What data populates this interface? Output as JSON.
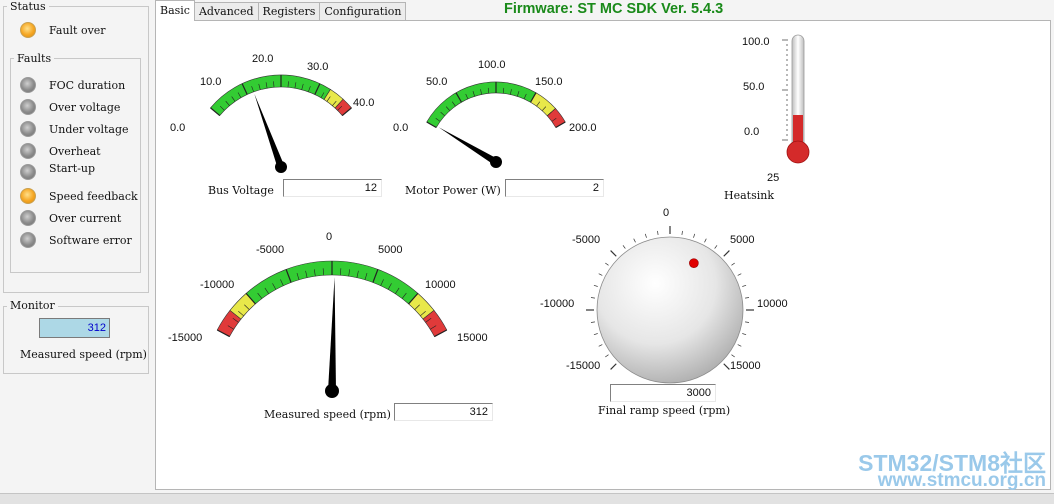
{
  "status_group": {
    "title": "Status",
    "items": [
      {
        "label": "Fault over",
        "state": "on"
      }
    ]
  },
  "faults_group": {
    "title": "Faults",
    "items": [
      {
        "label": "FOC duration",
        "state": "off"
      },
      {
        "label": "Over voltage",
        "state": "off"
      },
      {
        "label": "Under voltage",
        "state": "off"
      },
      {
        "label": "Overheat",
        "state": "off"
      },
      {
        "label": "Start-up",
        "state": "off"
      },
      {
        "label": "Speed feedback",
        "state": "on"
      },
      {
        "label": "Over current",
        "state": "off"
      },
      {
        "label": "Software error",
        "state": "off"
      }
    ]
  },
  "monitor_group": {
    "title": "Monitor",
    "value": "312",
    "label": "Measured speed (rpm)"
  },
  "tabs": [
    {
      "label": "Basic",
      "active": true
    },
    {
      "label": "Advanced",
      "active": false
    },
    {
      "label": "Registers",
      "active": false
    },
    {
      "label": "Configuration",
      "active": false
    }
  ],
  "firmware": "Firmware: ST MC SDK Ver. 5.4.3",
  "bus_voltage": {
    "label": "Bus Voltage",
    "value": "12",
    "gauge_value": 12,
    "min": 0,
    "max": 40,
    "tick_labels": [
      "0.0",
      "10.0",
      "20.0",
      "30.0",
      "40.0"
    ]
  },
  "motor_power": {
    "label": "Motor Power (W)",
    "value": "2",
    "gauge_value": 2,
    "min": 0,
    "max": 200,
    "tick_labels": [
      "0.0",
      "50.0",
      "100.0",
      "150.0",
      "200.0"
    ]
  },
  "heatsink": {
    "label": "Heatsink",
    "value": "25",
    "level": 25,
    "min": 0,
    "max": 100,
    "tick_labels": [
      "100.0",
      "50.0",
      "0.0"
    ]
  },
  "measured_speed": {
    "label": "Measured speed (rpm)",
    "value": "312",
    "gauge_value": 312,
    "min": -15000,
    "max": 15000,
    "tick_labels": [
      "-15000",
      "-10000",
      "-5000",
      "0",
      "5000",
      "10000",
      "15000"
    ]
  },
  "final_ramp_speed": {
    "label": "Final ramp speed (rpm)",
    "value": "3000",
    "knob_value": 3000,
    "min": -15000,
    "max": 15000,
    "tick_labels": [
      "-15000",
      "-10000",
      "-5000",
      "0",
      "5000",
      "10000",
      "15000"
    ]
  },
  "colors": {
    "green": "#33cc33",
    "yellow": "#e8e84a",
    "red": "#e03a3a",
    "firmware_green": "#1a8a1a",
    "led_on": "#f5a623",
    "monitor_bg": "#add8e6",
    "monitor_text": "#0000cc"
  },
  "watermark": {
    "line1": "STM32/STM8社区",
    "line2": "www.stmcu.org.cn"
  }
}
